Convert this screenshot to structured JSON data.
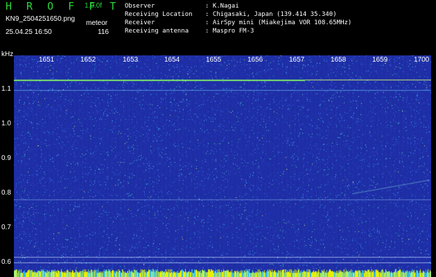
{
  "header": {
    "app_title": "H R O F F T",
    "version": "1.0.0f",
    "filename": "KN9_2504251650.png",
    "datetime": "25.04.25 16:50",
    "source_label": "meteor",
    "count": "116"
  },
  "meta": [
    {
      "key": "Observer",
      "value": ": K.Nagai"
    },
    {
      "key": "Receiving Location",
      "value": ": Chigasaki, Japan (139.414 35.340)"
    },
    {
      "key": "Receiver",
      "value": ": AirSpy mini (Miakejima VOR 108.65MHz)"
    },
    {
      "key": "Receiving antenna",
      "value": ": Maspro FM-3"
    }
  ],
  "axes": {
    "y_unit": "kHz",
    "y_ticks": [
      "1.1",
      "1.0",
      "0.9",
      "0.8",
      "0.7",
      "0.6"
    ],
    "x_ticks": [
      "1651",
      "1652",
      "1653",
      "1654",
      "1655",
      "1656",
      "1657",
      "1658",
      "1659",
      "1700"
    ]
  },
  "spectrogram": {
    "background_color": "#1f2fa8",
    "noise_colors": [
      "#1a2790",
      "#2a43c8",
      "#3a6ff0",
      "#2fb6e6",
      "#63e0c8",
      "#d7e85a"
    ],
    "carrier_color": "#7ee86b",
    "bottom_band_color": "#e8f000"
  }
}
